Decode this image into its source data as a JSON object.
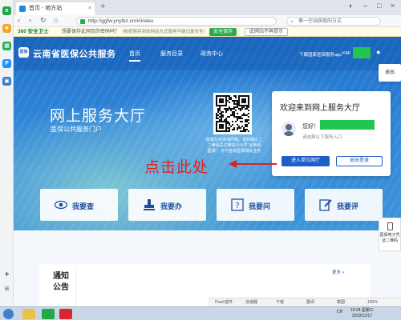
{
  "browser": {
    "tab_title": "首页 - 地方站",
    "tab_close": "×",
    "new_tab": "+",
    "url": "http://ggfw.ynylbz.cn/#/index",
    "search_placeholder": "第一空站获取的方式",
    "back": "‹",
    "forward": "›",
    "refresh": "↻",
    "home": "⌂",
    "minimize": "–",
    "maximize": "□",
    "close": "×"
  },
  "notification": {
    "brand": "360 安全卫士",
    "message": "想要保存此网页的密码吗？",
    "detail": "（帐密保存到本网站方式使用不能记录安全）",
    "save_label": "安全保存",
    "never_label": "此网站不再提示"
  },
  "sidebar": {
    "icons": [
      {
        "name": "360-browser-icon",
        "color": "#23a848",
        "glyph": "e"
      },
      {
        "name": "favorites-icon",
        "color": "#f5a623",
        "glyph": "★"
      },
      {
        "name": "apps-icon",
        "color": "#2dae55",
        "glyph": "▦"
      },
      {
        "name": "pay-icon",
        "color": "#1e90ff",
        "glyph": "P"
      },
      {
        "name": "screenshot-icon",
        "color": "#3478c6",
        "glyph": "▣"
      }
    ],
    "add": "+",
    "menu": "≡"
  },
  "site": {
    "logo_text": "医保",
    "name": "云南省医保公共服务",
    "nav": [
      "首页",
      "服务目录",
      "政务中心"
    ],
    "app_download": "下载国家医保服务app",
    "user_prefix": "KMI",
    "exit_label": "退出"
  },
  "hero": {
    "title": "网上服务大厅",
    "subtitle": "医保公共服务门户",
    "qr_caption": "如需在线咨询问题，请扫描以上二维码关注微信公众号“云南省医保”，并可查询医保相关业务",
    "annotation": "点击此处"
  },
  "welcome": {
    "title": "欢迎来到网上服务大厅",
    "hello": "您好！",
    "user_type": "请选择以下服务入口",
    "enter_button": "进入单位网厅",
    "logout_button": "退出登录"
  },
  "services": [
    {
      "label": "我要查",
      "icon": "eye-icon"
    },
    {
      "label": "我要办",
      "icon": "stamp-icon"
    },
    {
      "label": "我要问",
      "icon": "question-icon"
    },
    {
      "label": "我要评",
      "icon": "edit-icon"
    }
  ],
  "float_panel": {
    "label": "医保电子凭证二维码"
  },
  "notice": {
    "title_line1": "通知",
    "title_line2": "公告",
    "more": "更多 »"
  },
  "statusbar": {
    "items": [
      "Flash插件",
      "加速器",
      "下载",
      "翻译",
      "截图",
      "100%"
    ]
  },
  "taskbar": {
    "time": "10:24 星期三",
    "date": "2019/12/17",
    "lang": "CH",
    "colors": {
      "start": "#3d7fd0",
      "wps": "#d9262c",
      "excel": "#1d8c4a",
      "browser": "#23a848"
    }
  }
}
